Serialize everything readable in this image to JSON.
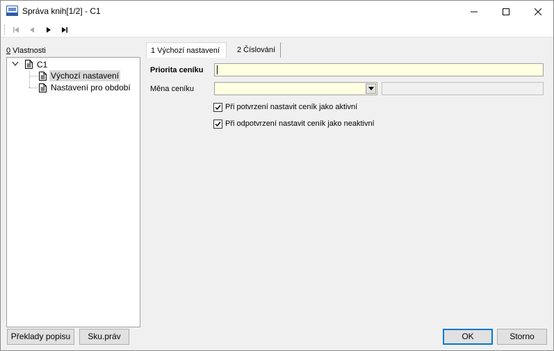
{
  "window": {
    "title": "Správa knih[1/2] - C1"
  },
  "left_panel": {
    "label_key": "0",
    "label_rest": " Vlastnosti",
    "tree": {
      "root": "C1",
      "children": [
        "Výchozí nastavení",
        "Nastavení pro období"
      ]
    },
    "buttons": {
      "translations": "Překlady popisu",
      "rights": "Sku.práv"
    }
  },
  "tabs": [
    {
      "label": "1 Výchozí nastavení"
    },
    {
      "label": "2 Číslování"
    }
  ],
  "form": {
    "priority_label": "Priorita ceníku",
    "priority_value": "",
    "currency_label": "Měna ceníku",
    "currency_value": "",
    "currency_desc": "",
    "check1": {
      "label": "Při potvrzení nastavit ceník jako aktivní",
      "checked": true
    },
    "check2": {
      "label": "Při odpotvrzení nastavit ceník jako neaktivní",
      "checked": true
    }
  },
  "dialog_buttons": {
    "ok": "OK",
    "cancel": "Storno"
  }
}
